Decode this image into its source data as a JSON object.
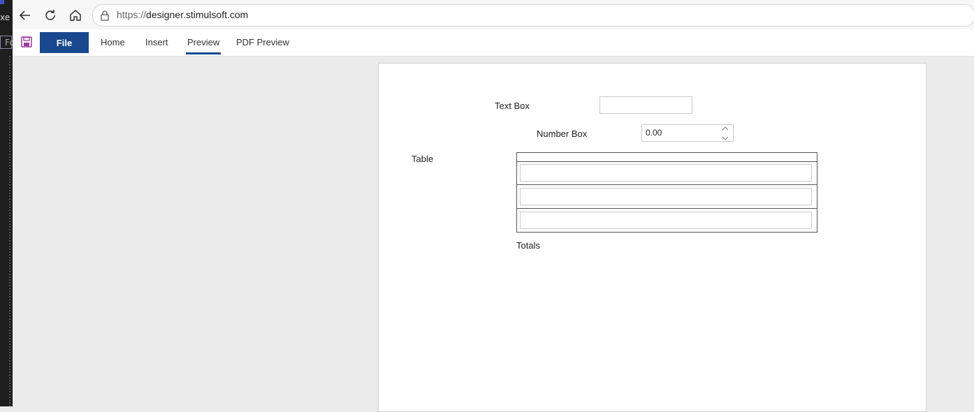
{
  "browser": {
    "url_scheme": "https://",
    "url_host": "designer.stimulsoft.com",
    "side_fragment_top": "xe",
    "side_fragment_field": "Fo"
  },
  "ribbon": {
    "file_label": "File",
    "tabs": [
      {
        "label": "Home"
      },
      {
        "label": "Insert"
      },
      {
        "label": "Preview"
      },
      {
        "label": "PDF Preview"
      }
    ],
    "active_tab": "Preview",
    "accent_color": "#19488e"
  },
  "form": {
    "text_box_label": "Text Box",
    "text_box_value": "",
    "number_box_label": "Number Box",
    "number_box_value": "0.00",
    "table_label": "Table",
    "table_rows": [
      "",
      "",
      ""
    ],
    "totals_label": "Totals"
  }
}
